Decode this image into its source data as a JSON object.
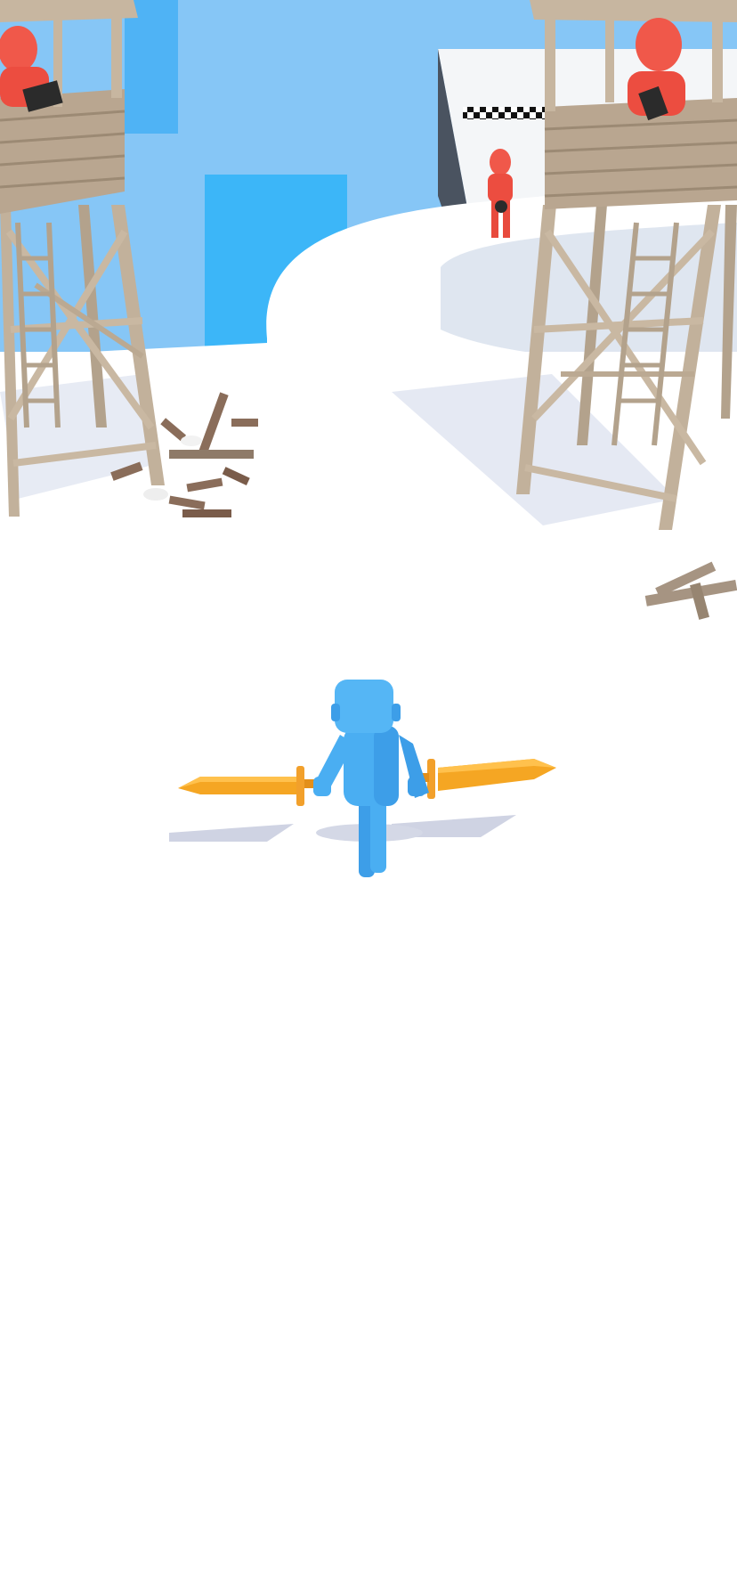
{
  "scene": {
    "sky_color": "#86c6f6",
    "ground_color": "#ffffff",
    "player": {
      "body_color": "#4aaef2",
      "weapon": "dual-swords",
      "sword_color": "#f5a623"
    },
    "enemies": [
      {
        "position": "left-watchtower",
        "color": "#f0584a",
        "holding": "gun"
      },
      {
        "position": "right-watchtower",
        "color": "#f0584a",
        "holding": "gun"
      },
      {
        "position": "on-path",
        "color": "#f0584a",
        "holding": "gun"
      }
    ],
    "watchtowers": [
      {
        "side": "left"
      },
      {
        "side": "right"
      }
    ],
    "finish_line": "checkered"
  }
}
